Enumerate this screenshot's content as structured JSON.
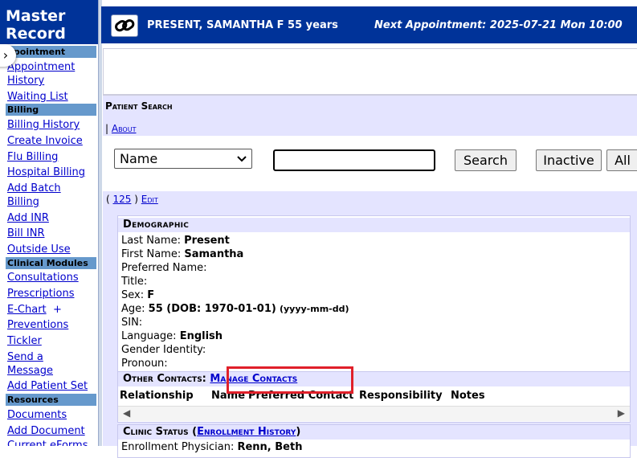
{
  "sidebar": {
    "title_line1": "Master",
    "title_line2": "Record",
    "appointment_section": "ppointment",
    "appointment_history_1": "Appointment",
    "appointment_history_2": "History",
    "waiting_list": "Waiting List",
    "billing_section": "Billing",
    "billing_history": "Billing History",
    "create_invoice": "Create Invoice",
    "flu_billing": "Flu Billing",
    "hospital_billing": "Hospital Billing",
    "add_batch_billing_1": "Add Batch",
    "add_batch_billing_2": "Billing",
    "add_inr": "Add INR",
    "bill_inr": "Bill INR",
    "outside_use": "Outside Use",
    "clinical_section": "Clinical Modules",
    "consultations": "Consultations",
    "prescriptions": "Prescriptions",
    "echart": "E-Chart",
    "echart_plus": "+",
    "preventions": "Preventions",
    "tickler": "Tickler",
    "send_message_1": "Send a",
    "send_message_2": "Message",
    "add_patient_set": "Add Patient Set",
    "resources_section": "Resources",
    "documents": "Documents",
    "add_document": "Add Document",
    "current_eforms": "Current eForms"
  },
  "header": {
    "patient": "PRESENT, SAMANTHA F 55 years",
    "next_appointment": "Next Appointment: 2025-07-21 Mon 10:00"
  },
  "search": {
    "title": "Patient Search",
    "about_prefix": "|",
    "about": "About",
    "search_by": "Name",
    "query": "",
    "search_button": "Search",
    "inactive_button": "Inactive",
    "all_button": "All"
  },
  "record": {
    "open_paren": "(",
    "id": "125",
    "close_paren": ")",
    "edit": "Edit"
  },
  "demographic": {
    "heading": "Demographic",
    "last_name_label": "Last Name:",
    "last_name": "Present",
    "first_name_label": "First Name:",
    "first_name": "Samantha",
    "preferred_name_label": "Preferred Name:",
    "title_label": "Title:",
    "sex_label": "Sex:",
    "sex": "F",
    "age_label": "Age:",
    "age": "55 (DOB: 1970-01-01)",
    "dob_format": "(yyyy-mm-dd)",
    "sin_label": "SIN:",
    "language_label": "Language:",
    "language": "English",
    "gender_identity_label": "Gender Identity:",
    "pronoun_label": "Pronoun:"
  },
  "contacts": {
    "heading": "Other Contacts:",
    "manage": "Manage Contacts",
    "columns": [
      "Relationship",
      "Name",
      "Preferred Contact",
      "Responsibility",
      "Notes"
    ],
    "scroll_left": "◀",
    "scroll_right": "▶"
  },
  "clinic_status": {
    "heading": "Clinic Status",
    "open_paren": "(",
    "enrollment_history": "Enrollment History",
    "close_paren": ")",
    "enrollment_physician_label": "Enrollment Physician:",
    "enrollment_physician": "Renn, Beth"
  },
  "icons": {
    "header_logo": "link-chain-icon",
    "collapse": "chevron-right-icon",
    "select": "chevron-down-icon"
  },
  "colors": {
    "header_bg": "#003399",
    "section_bg": "#6699cc",
    "panel_bg": "#e4e4ff",
    "highlight": "#e0202a",
    "link": "#0000cc"
  }
}
